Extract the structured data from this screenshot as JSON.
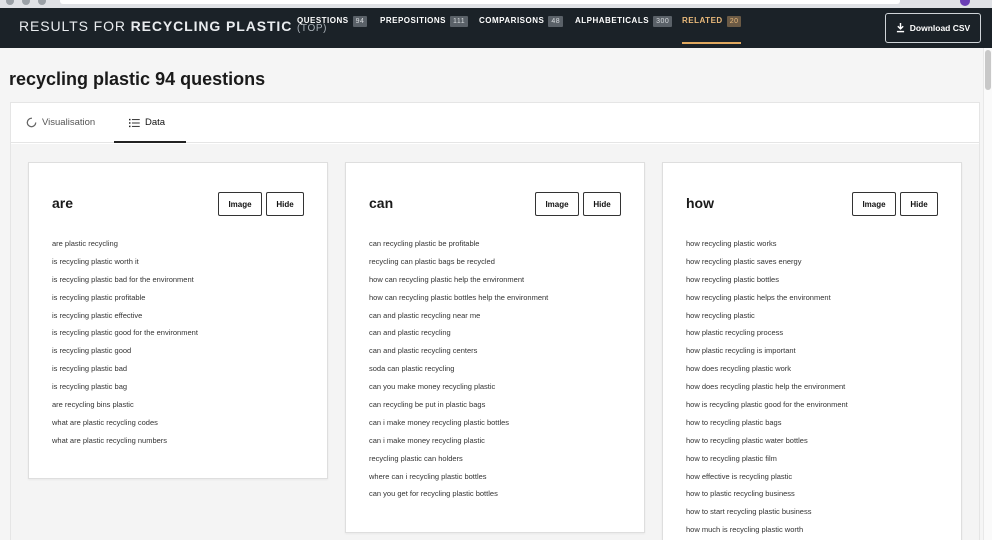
{
  "header": {
    "results_prefix": "RESULTS FOR",
    "keyword": "RECYCLING PLASTIC",
    "scope": "(TOP)",
    "tabs": [
      {
        "label": "QUESTIONS",
        "count": "94"
      },
      {
        "label": "PREPOSITIONS",
        "count": "111"
      },
      {
        "label": "COMPARISONS",
        "count": "48"
      },
      {
        "label": "ALPHABETICALS",
        "count": "300"
      },
      {
        "label": "RELATED",
        "count": "20"
      }
    ],
    "active_tab": "RELATED",
    "download_label": "Download CSV",
    "bar_color": "#1b2228",
    "accent_color": "#e0a85f"
  },
  "title": {
    "keyword": "recycling plastic",
    "rest": " 94 questions"
  },
  "view_tabs": {
    "visualisation": "Visualisation",
    "data": "Data",
    "active": "Data"
  },
  "cards": [
    {
      "heading": "are",
      "image_label": "Image",
      "hide_label": "Hide",
      "items": [
        "are plastic recycling",
        "is recycling plastic worth it",
        "is recycling plastic bad for the environment",
        "is recycling plastic profitable",
        "is recycling plastic effective",
        "is recycling plastic good for the environment",
        "is recycling plastic good",
        "is recycling plastic bad",
        "is recycling plastic bag",
        "are recycling bins plastic",
        "what are plastic recycling codes",
        "what are plastic recycling numbers"
      ]
    },
    {
      "heading": "can",
      "image_label": "Image",
      "hide_label": "Hide",
      "items": [
        "can recycling plastic be profitable",
        "recycling can plastic bags be recycled",
        "how can recycling plastic help the environment",
        "how can recycling plastic bottles help the environment",
        "can and plastic recycling near me",
        "can and plastic recycling",
        "can and plastic recycling centers",
        "soda can plastic recycling",
        "can you make money recycling plastic",
        "can recycling be put in plastic bags",
        "can i make money recycling plastic bottles",
        "can i make money recycling plastic",
        "recycling plastic can holders",
        "where can i recycling plastic bottles",
        "can you get for recycling plastic bottles"
      ]
    },
    {
      "heading": "how",
      "image_label": "Image",
      "hide_label": "Hide",
      "items": [
        "how recycling plastic works",
        "how recycling plastic saves energy",
        "how recycling plastic bottles",
        "how recycling plastic helps the environment",
        "how recycling plastic",
        "how plastic recycling process",
        "how plastic recycling is important",
        "how does recycling plastic work",
        "how does recycling plastic help the environment",
        "how is recycling plastic good for the environment",
        "how to recycling plastic bags",
        "how to recycling plastic water bottles",
        "how to recycling plastic film",
        "how effective is recycling plastic",
        "how to plastic recycling business",
        "how to start recycling plastic business",
        "how much is recycling plastic worth"
      ]
    }
  ]
}
